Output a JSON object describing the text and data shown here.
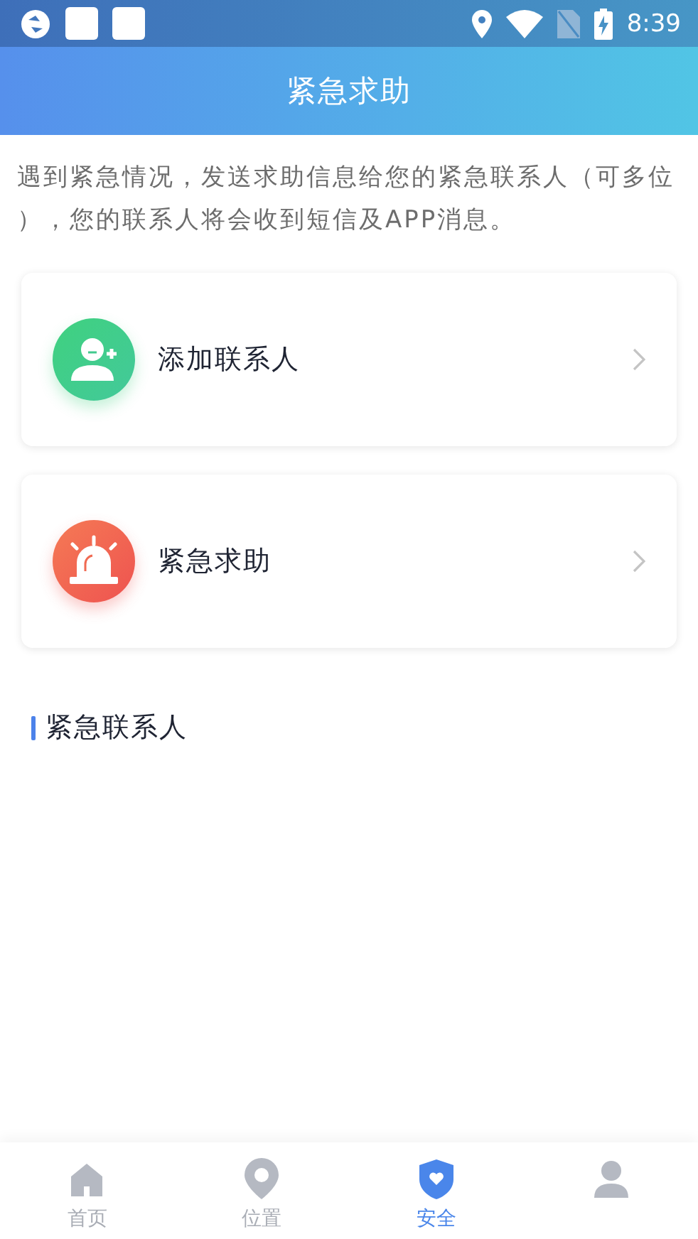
{
  "status_bar": {
    "time": "8:39"
  },
  "header": {
    "title": "紧急求助"
  },
  "intro": "遇到紧急情况，发送求助信息给您的紧急联系人（可多位），您的联系人将会收到短信及APP消息。",
  "cards": [
    {
      "kind": "add-contact",
      "label": "添加联系人"
    },
    {
      "kind": "sos",
      "label": "紧急求助"
    }
  ],
  "section": {
    "title": "紧急联系人"
  },
  "tabs": [
    {
      "kind": "home",
      "label": "首页",
      "selected": false
    },
    {
      "kind": "location",
      "label": "位置",
      "selected": false
    },
    {
      "kind": "safety",
      "label": "安全",
      "selected": true
    },
    {
      "kind": "profile",
      "selected": false
    }
  ]
}
